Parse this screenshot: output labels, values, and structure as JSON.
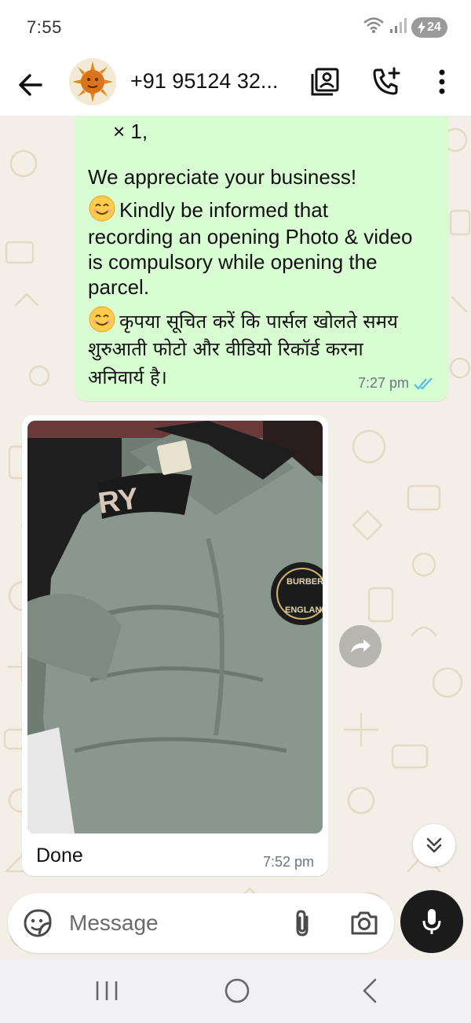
{
  "status_bar": {
    "time": "7:55",
    "battery_level": "24",
    "icons": [
      "wifi-icon",
      "signal-icon",
      "battery-charging-icon"
    ]
  },
  "header": {
    "contact_name": "+91 95124 32...",
    "icons": [
      "back-arrow-icon",
      "avatar",
      "contact-card-icon",
      "add-call-icon",
      "more-vert-icon"
    ]
  },
  "chat": {
    "outgoing": {
      "lines": [
        "× 1,",
        "We appreciate your business!",
        "Kindly be informed that",
        "recording an opening Photo & video",
        "is compulsory while opening the",
        "parcel.",
        "कृपया सूचित करें कि पार्सल खोलते समय",
        "शुरुआती फोटो और वीडियो रिकॉर्ड करना",
        "अनिवार्य है।"
      ],
      "time": "7:27 pm",
      "status": "read",
      "emoji": "smiling-face-emoji"
    },
    "incoming": {
      "caption": "Done",
      "time": "7:52 pm",
      "image_label": {
        "badge_line1": "BURBERRY",
        "badge_line2": "ENGLAND",
        "collar_text": "RY"
      }
    },
    "buttons": [
      "forward-icon",
      "scroll-down-icon"
    ]
  },
  "composer": {
    "placeholder": "Message",
    "icons": [
      "sticker-icon",
      "attach-icon",
      "camera-icon",
      "mic-icon"
    ]
  },
  "colors": {
    "outgoing_bubble": "#d9fdd3",
    "incoming_bubble": "#ffffff",
    "wallpaper": "#f4efe6",
    "read_tick": "#53bdeb",
    "mic_button": "#1b1b1b"
  },
  "nav_bar": {
    "icons": [
      "recent-apps-icon",
      "home-icon",
      "back-icon"
    ]
  }
}
